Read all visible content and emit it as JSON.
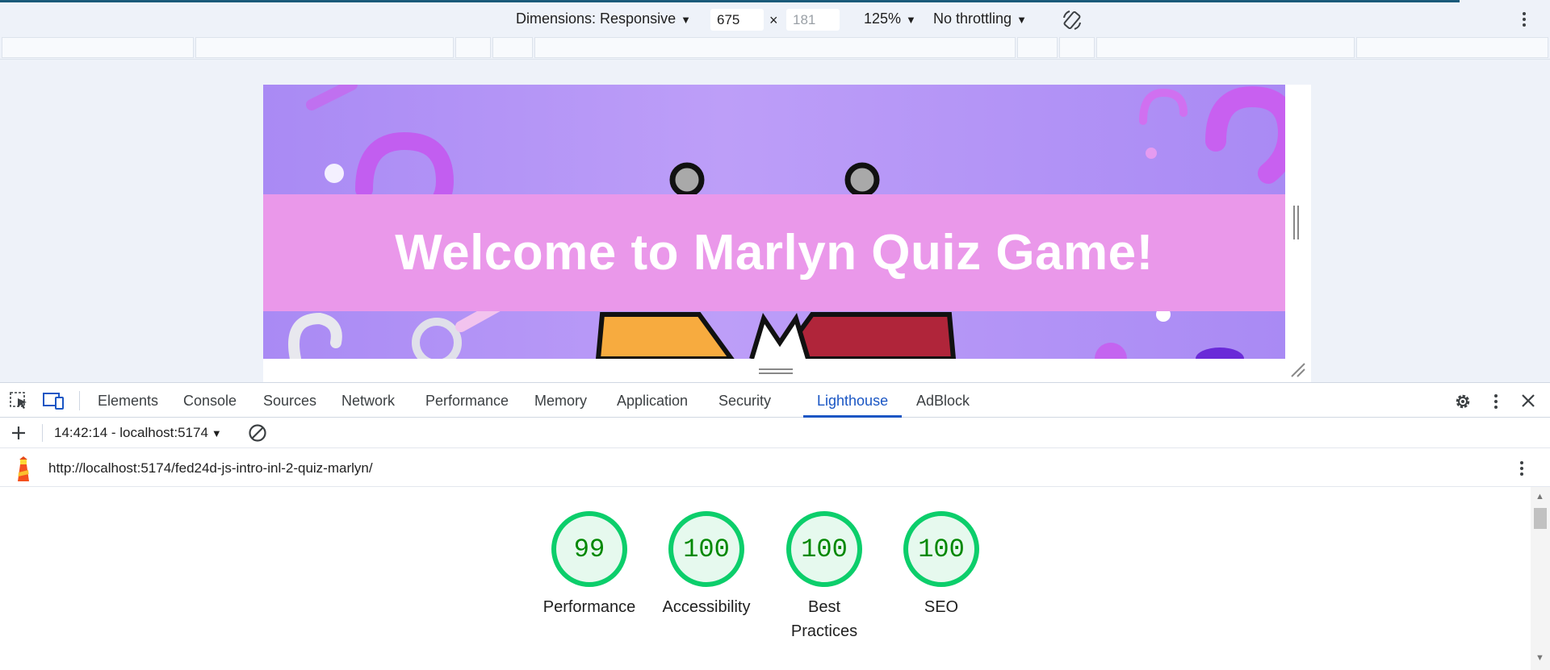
{
  "device_toolbar": {
    "dimensions_label": "Dimensions: Responsive",
    "width_value": "675",
    "times": "×",
    "height_value": "181",
    "zoom": "125%",
    "throttling": "No throttling",
    "icons": [
      "rotate-icon",
      "more-vert-icon"
    ]
  },
  "page_preview": {
    "title": "Welcome to Marlyn Quiz Game!",
    "colors": {
      "background": "#a98af4",
      "band": "#ea98ea",
      "title": "#ffffff"
    }
  },
  "devtools": {
    "tabs": [
      "Elements",
      "Console",
      "Sources",
      "Network",
      "Performance",
      "Memory",
      "Application",
      "Security",
      "Lighthouse",
      "AdBlock"
    ],
    "active_tab": "Lighthouse",
    "icons": [
      "inspect-icon",
      "device-toggle-icon",
      "settings-icon",
      "more-vert-icon",
      "close-icon"
    ]
  },
  "lighthouse": {
    "report_select": "14:42:14 - localhost:5174",
    "url": "http://localhost:5174/fed24d-js-intro-inl-2-quiz-marlyn/",
    "scores": [
      {
        "value": "99",
        "label": "Performance"
      },
      {
        "value": "100",
        "label": "Accessibility"
      },
      {
        "value": "100",
        "label": "Best Practices"
      },
      {
        "value": "100",
        "label": "SEO"
      }
    ],
    "colors": {
      "pass": "#0cce6b",
      "pass_text": "#008800",
      "pass_fill": "#e6f9ee",
      "active_tab": "#1a56c4"
    }
  }
}
